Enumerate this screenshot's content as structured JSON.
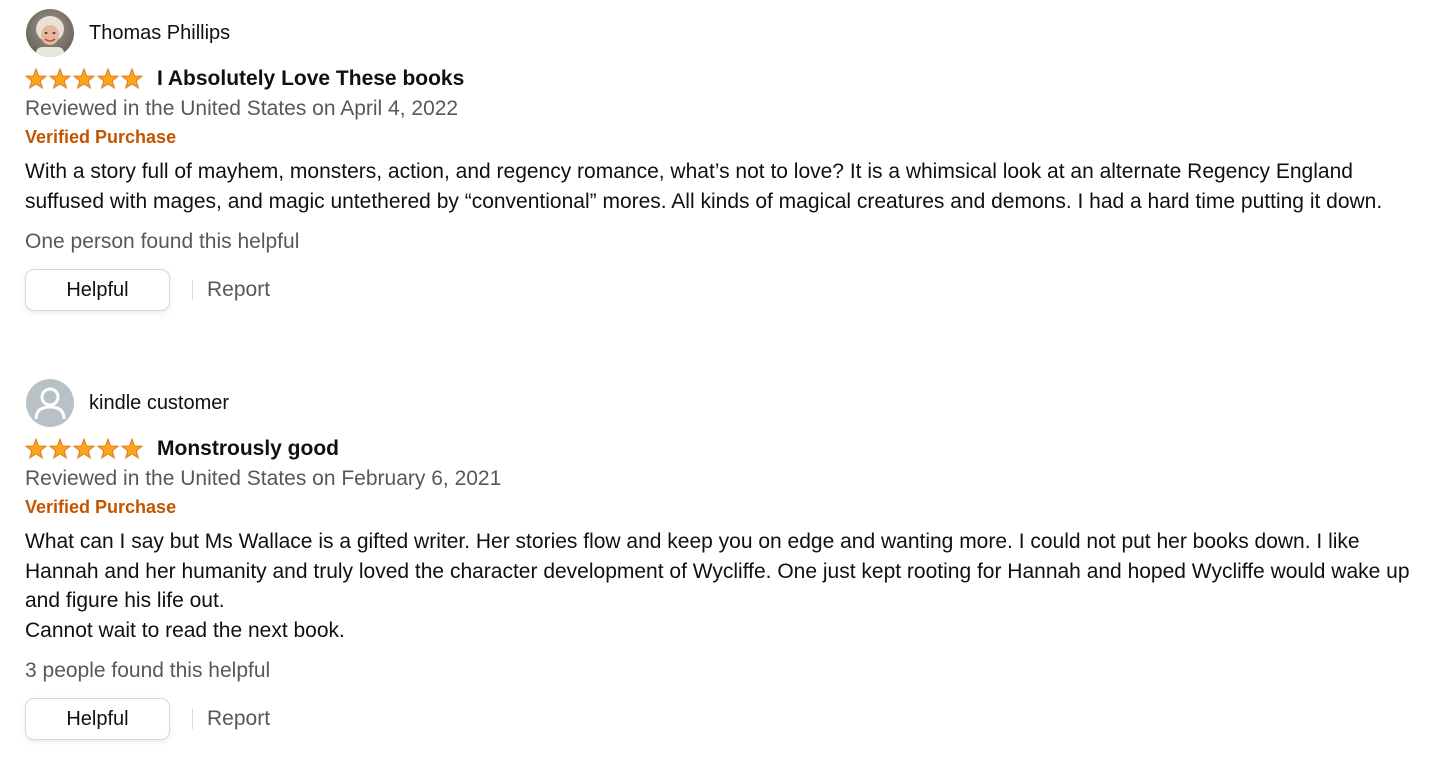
{
  "colors": {
    "star": "#ffa41c",
    "star_edge": "#de7921",
    "verified": "#c45500",
    "secondary_text": "#565959",
    "primary_text": "#0f1111"
  },
  "reviews": [
    {
      "profile_name": "Thomas Phillips",
      "avatar": "profile-photo",
      "rating": 5,
      "title": "I Absolutely Love These books",
      "date": "Reviewed in the United States on April 4, 2022",
      "verified": "Verified Purchase",
      "body": "With a story full of mayhem, monsters, action, and regency romance, what’s not to love? It is a whimsical look at an alternate Regency England suffused with mages, and magic untethered by “conventional” mores. All kinds of magical creatures and demons. I had a hard time putting it down.",
      "helpful_count": "One person found this helpful",
      "helpful_label": "Helpful",
      "report_label": "Report"
    },
    {
      "profile_name": "kindle customer",
      "avatar": "default-avatar-icon",
      "rating": 5,
      "title": "Monstrously good",
      "date": "Reviewed in the United States on February 6, 2021",
      "verified": "Verified Purchase",
      "body": "What can I say but Ms Wallace is a gifted writer. Her stories flow and keep you on edge and wanting more. I could not put her books down. I like Hannah and her humanity and truly loved the character development of Wycliffe. One just kept rooting for Hannah and hoped Wycliffe would wake up and figure his life out.\nCannot wait to read the next book.",
      "helpful_count": "3 people found this helpful",
      "helpful_label": "Helpful",
      "report_label": "Report"
    }
  ]
}
